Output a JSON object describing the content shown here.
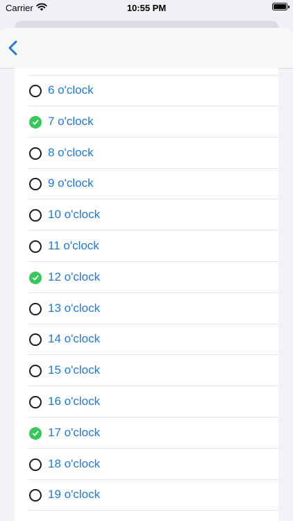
{
  "status_bar": {
    "carrier": "Carrier",
    "time": "10:55 PM"
  },
  "colors": {
    "accent": "#1f7ad6",
    "checked": "#34c759"
  },
  "nav": {
    "back_icon": "chevron-left-icon"
  },
  "hours": [
    {
      "label": "6 o'clock",
      "checked": false
    },
    {
      "label": "7 o'clock",
      "checked": true
    },
    {
      "label": "8 o'clock",
      "checked": false
    },
    {
      "label": "9 o'clock",
      "checked": false
    },
    {
      "label": "10 o'clock",
      "checked": false
    },
    {
      "label": "11 o'clock",
      "checked": false
    },
    {
      "label": "12 o'clock",
      "checked": true
    },
    {
      "label": "13 o'clock",
      "checked": false
    },
    {
      "label": "14 o'clock",
      "checked": false
    },
    {
      "label": "15 o'clock",
      "checked": false
    },
    {
      "label": "16 o'clock",
      "checked": false
    },
    {
      "label": "17 o'clock",
      "checked": true
    },
    {
      "label": "18 o'clock",
      "checked": false
    },
    {
      "label": "19 o'clock",
      "checked": false
    }
  ]
}
